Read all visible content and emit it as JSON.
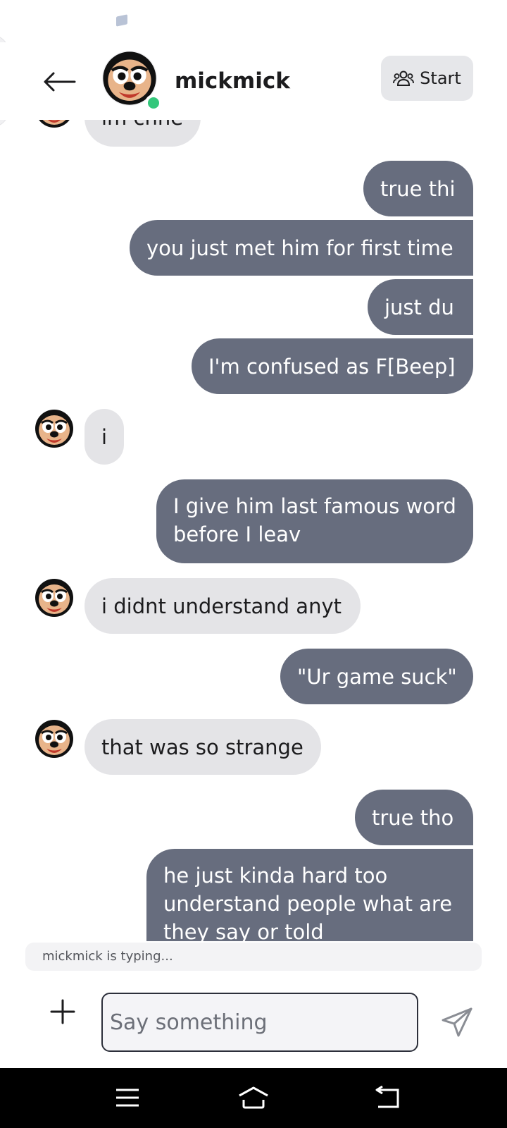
{
  "header": {
    "contact_name": "mickmick",
    "start_label": "Start",
    "online": true
  },
  "messages": [
    {
      "from": "them",
      "text": "im chne",
      "clipped": true
    },
    {
      "from": "me",
      "text": "true thi"
    },
    {
      "from": "me",
      "text": "you just met him for first time"
    },
    {
      "from": "me",
      "text": "just du"
    },
    {
      "from": "me",
      "text": "I'm confused as F[Beep]"
    },
    {
      "from": "them",
      "text": "i"
    },
    {
      "from": "me",
      "text": "I give him last famous word before I leav"
    },
    {
      "from": "them",
      "text": "i didnt understand anyt"
    },
    {
      "from": "me",
      "text": "\"Ur game suck\""
    },
    {
      "from": "them",
      "text": "that was so strange"
    },
    {
      "from": "me",
      "text": "true tho"
    },
    {
      "from": "me",
      "text": "he just kinda hard too understand people what are they say or told",
      "clipped": true
    }
  ],
  "typing_indicator": "mickmick is typing...",
  "composer": {
    "placeholder": "Say something"
  },
  "colors": {
    "outgoing_bubble": "#676d7e",
    "incoming_bubble": "#e4e4e7",
    "online_dot": "#34c77b",
    "start_button_bg": "#e6e7ea"
  },
  "icons": {
    "back": "arrow-left-icon",
    "start": "people-group-icon",
    "add": "plus-icon",
    "send": "paper-plane-icon",
    "nav_menu": "menu-lines-icon",
    "nav_home": "home-icon",
    "nav_back": "return-icon"
  }
}
